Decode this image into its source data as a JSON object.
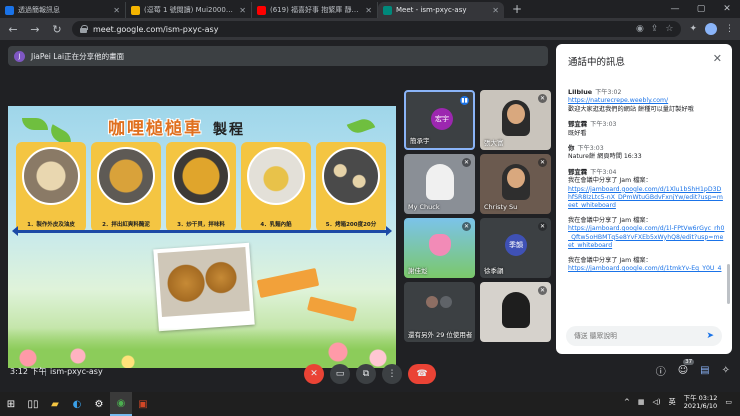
{
  "browser": {
    "tabs": [
      {
        "label": "透過簡報訊息",
        "fav_color": "#1a73e8"
      },
      {
        "label": "(逗莓 1 號閱讀) Mui2000哲平遠",
        "fav_color": "#f4b400"
      },
      {
        "label": "(619) 福喜好事 抱緊庫 靜眾 BGM",
        "fav_color": "#ff0000"
      },
      {
        "label": "Meet - ism-pxyc-asy",
        "fav_color": "#00897b",
        "active": true
      }
    ],
    "url": "meet.google.com/ism-pxyc-asy"
  },
  "meet": {
    "presenting_avatar": "J",
    "presenting_text": "JiaPei Lai正在分享他的畫面",
    "slide": {
      "title": "咖哩槌槌車",
      "subtitle": "製程",
      "steps": [
        "1．製作外皮及油皮",
        "2．拌出紅爽料醃泥",
        "3．炒干貝，拌味料",
        "4．乳麵內餡",
        "5．烤箱200度20分"
      ]
    },
    "tiles": [
      {
        "name": "簡承宇",
        "avatar": "宏宇",
        "color": "#9c27b0",
        "pinned": true,
        "mic": "▮▮"
      },
      {
        "name": "張大富",
        "mic": "✕"
      },
      {
        "name": "My Chuck",
        "mic": "✕"
      },
      {
        "name": "Christy Su",
        "mic": "✕"
      },
      {
        "name": "謝佳彣",
        "mic": "✕"
      },
      {
        "name": "徐季韻",
        "avatar": "季韻",
        "color": "#3f51b5",
        "mic": "✕"
      },
      {
        "name": "還有另外 29 位使用者"
      },
      {
        "name": "",
        "mic": "✕"
      }
    ],
    "time": "3:12 下午",
    "separator": "|",
    "meeting_code": "ism-pxyc-asy",
    "participant_count": "37"
  },
  "chat": {
    "header": "通話中的訊息",
    "messages": [
      {
        "sender": "Lilblue",
        "time": "下午3:02",
        "link": "https://naturecrepe.weebly.com/",
        "text": "歡迎大家逛逛我們的網站 餅種可以量訂製好哦"
      },
      {
        "sender": "鄧宜霖",
        "time": "下午3:03",
        "text": "既好看"
      },
      {
        "sender": "你",
        "time": "下午3:03",
        "text": "Nature餅 網頁時間  16:33"
      },
      {
        "sender": "鄧宜霖",
        "time": "下午3:04",
        "text": "我在會議中分享了 Jam 檔案：",
        "link": "https://jamboard.google.com/d/1Xlu1bShH1pD3D hfSR8IzLtc5-nX_DPmWtuGBdvFxnjYw/edit?usp=meet_whiteboard"
      },
      {
        "text": "我在會議中分享了 Jam 檔案：",
        "link": "https://jamboard.google.com/d/1l-FPtVw6rGyc_rh0_Qftw5oHBMTq5e8YvFXEb5xWyhQ8/edit?usp=meet_whiteboard"
      },
      {
        "text": "我在會議中分享了 Jam 檔案：",
        "link": "https://jamboard.google.com/d/1tmkYv-Eq_Y0U_4"
      }
    ],
    "input_placeholder": "傳送 聽眾說明"
  },
  "taskbar": {
    "clock_time": "下午 03:12",
    "clock_date": "2021/6/10",
    "ime": "英"
  },
  "colors": {
    "meet_bg": "#202124",
    "hangup_red": "#ea4335",
    "link_blue": "#1a73e8"
  }
}
